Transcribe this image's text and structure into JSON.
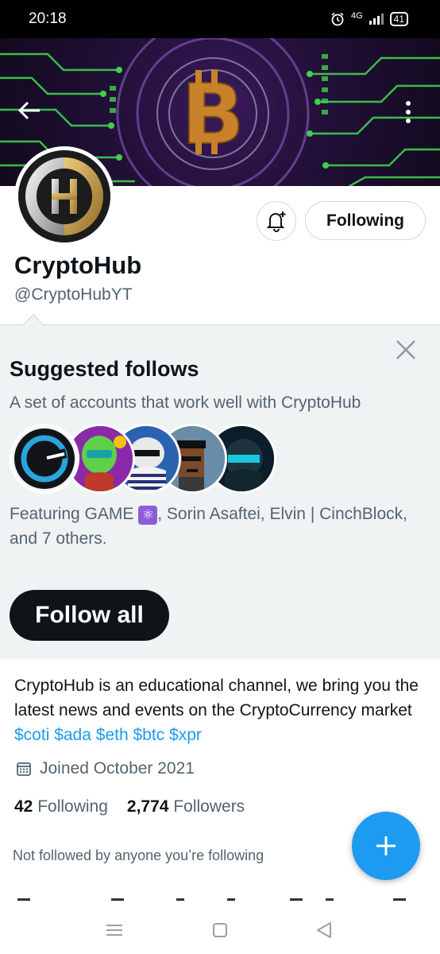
{
  "status_bar": {
    "time": "20:18",
    "network": "4G",
    "battery": "41"
  },
  "profile": {
    "display_name": "CryptoHub",
    "handle": "@CryptoHubYT",
    "following_button": "Following",
    "bio_text": "CryptoHub is an educational channel, we bring you the latest news and events on the CryptoCurrency market ",
    "bio_tags": [
      "$coti",
      "$ada",
      "$eth",
      "$btc",
      "$xpr"
    ],
    "joined": "Joined October 2021",
    "following_count": "42",
    "following_label": "Following",
    "followers_count": "2,774",
    "followers_label": "Followers",
    "not_followed": "Not followed by anyone you’re following"
  },
  "suggested": {
    "title": "Suggested follows",
    "subtitle": "A set of accounts that work well with CryptoHub",
    "featuring_prefix": "Featuring GAME ",
    "featuring_emoji": "⚛",
    "featuring_suffix": ", Sorin Asaftei, Elvin | CinchBlock, and 7 others.",
    "follow_all": "Follow all",
    "avatars": [
      "coti-avatar",
      "alien-avatar",
      "penguin-avatar",
      "pixel-punk-avatar",
      "cyber-avatar"
    ]
  },
  "colors": {
    "accent": "#1d9bf0",
    "text_primary": "#0f1419",
    "text_secondary": "#536471",
    "section_bg": "#eff3f4"
  },
  "icons": {
    "back": "back-arrow-icon",
    "more": "more-vertical-icon",
    "bell": "notification-bell-plus-icon",
    "close": "close-icon",
    "calendar": "calendar-icon",
    "compose": "plus-icon"
  }
}
